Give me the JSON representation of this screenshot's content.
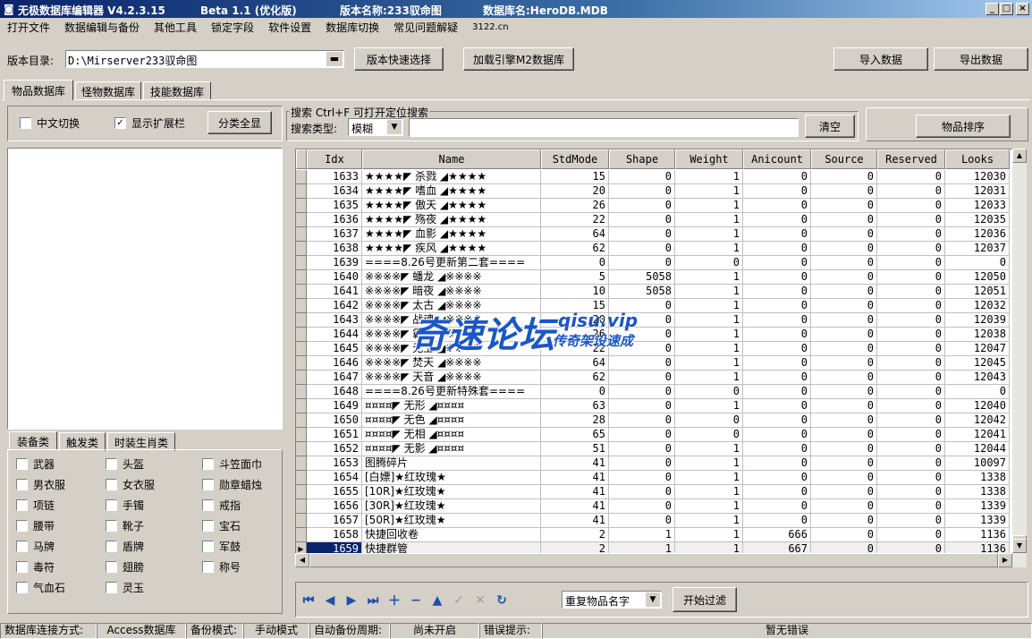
{
  "title": {
    "app": "无极数据库编辑器 V4.2.3.15",
    "beta": "Beta 1.1 (优化版)",
    "version_label": "版本名称:233驭命图",
    "db_label": "数据库名:HeroDB.MDB"
  },
  "menu": [
    "打开文件",
    "数据编辑与备份",
    "其他工具",
    "锁定字段",
    "软件设置",
    "数据库切换",
    "常见问题解疑",
    "3122.cn"
  ],
  "toolbar": {
    "dir_label": "版本目录:",
    "dir_value": "D:\\Mirserver233驭命图",
    "quick_select": "版本快速选择",
    "load_engine": "加载引擎M2数据库",
    "import": "导入数据",
    "export": "导出数据"
  },
  "tabs": [
    "物品数据库",
    "怪物数据库",
    "技能数据库"
  ],
  "left_panel": {
    "chinese_toggle": "中文切换",
    "show_ext": "显示扩展栏",
    "show_all": "分类全显",
    "cat_tabs": [
      "装备类",
      "触发类",
      "时装生肖类"
    ],
    "categories": [
      [
        "武器",
        "头盔",
        "斗笠面巾"
      ],
      [
        "男衣服",
        "女衣服",
        "勋章蜡烛"
      ],
      [
        "项链",
        "手镯",
        "戒指"
      ],
      [
        "腰带",
        "靴子",
        "宝石"
      ],
      [
        "马牌",
        "盾牌",
        "军鼓"
      ],
      [
        "毒符",
        "翅膀",
        "称号"
      ],
      [
        "气血石",
        "灵玉",
        ""
      ]
    ]
  },
  "search": {
    "title": "搜索 Ctrl+F 可打开定位搜索",
    "type_label": "搜索类型:",
    "type_value": "模糊",
    "query": "",
    "clear": "清空",
    "sort": "物品排序"
  },
  "grid": {
    "columns": [
      "Idx",
      "Name",
      "StdMode",
      "Shape",
      "Weight",
      "Anicount",
      "Source",
      "Reserved",
      "Looks"
    ],
    "rows": [
      [
        "1633",
        "★★★★◤ 杀戮 ◢★★★★",
        "15",
        "0",
        "1",
        "0",
        "0",
        "0",
        "12030"
      ],
      [
        "1634",
        "★★★★◤ 嗜血 ◢★★★★",
        "20",
        "0",
        "1",
        "0",
        "0",
        "0",
        "12031"
      ],
      [
        "1635",
        "★★★★◤ 傲天 ◢★★★★",
        "26",
        "0",
        "1",
        "0",
        "0",
        "0",
        "12033"
      ],
      [
        "1636",
        "★★★★◤ 殇夜 ◢★★★★",
        "22",
        "0",
        "1",
        "0",
        "0",
        "0",
        "12035"
      ],
      [
        "1637",
        "★★★★◤ 血影 ◢★★★★",
        "64",
        "0",
        "1",
        "0",
        "0",
        "0",
        "12036"
      ],
      [
        "1638",
        "★★★★◤ 疾风 ◢★★★★",
        "62",
        "0",
        "1",
        "0",
        "0",
        "0",
        "12037"
      ],
      [
        "1639",
        "====8.26号更新第二套====",
        "0",
        "0",
        "0",
        "0",
        "0",
        "0",
        "0"
      ],
      [
        "1640",
        "※※※※◤ 蟠龙 ◢※※※※",
        "5",
        "5058",
        "1",
        "0",
        "0",
        "0",
        "12050"
      ],
      [
        "1641",
        "※※※※◤ 暗夜 ◢※※※※",
        "10",
        "5058",
        "1",
        "0",
        "0",
        "0",
        "12051"
      ],
      [
        "1642",
        "※※※※◤ 太古 ◢※※※※",
        "15",
        "0",
        "1",
        "0",
        "0",
        "0",
        "12032"
      ],
      [
        "1643",
        "※※※※◤ 战魂 ◢※※※※",
        "20",
        "0",
        "1",
        "0",
        "0",
        "0",
        "12039"
      ],
      [
        "1644",
        "※※※※◤ 霸者 ◢※※※※",
        "26",
        "0",
        "1",
        "0",
        "0",
        "0",
        "12038"
      ],
      [
        "1645",
        "※※※※◤ 无上 ◢※※※※",
        "22",
        "0",
        "1",
        "0",
        "0",
        "0",
        "12047"
      ],
      [
        "1646",
        "※※※※◤ 焚天 ◢※※※※",
        "64",
        "0",
        "1",
        "0",
        "0",
        "0",
        "12045"
      ],
      [
        "1647",
        "※※※※◤ 天音 ◢※※※※",
        "62",
        "0",
        "1",
        "0",
        "0",
        "0",
        "12043"
      ],
      [
        "1648",
        "====8.26号更新特殊套====",
        "0",
        "0",
        "0",
        "0",
        "0",
        "0",
        "0"
      ],
      [
        "1649",
        "¤¤¤¤◤ 无形 ◢¤¤¤¤",
        "63",
        "0",
        "1",
        "0",
        "0",
        "0",
        "12040"
      ],
      [
        "1650",
        "¤¤¤¤◤ 无色 ◢¤¤¤¤",
        "28",
        "0",
        "0",
        "0",
        "0",
        "0",
        "12042"
      ],
      [
        "1651",
        "¤¤¤¤◤ 无相 ◢¤¤¤¤",
        "65",
        "0",
        "0",
        "0",
        "0",
        "0",
        "12041"
      ],
      [
        "1652",
        "¤¤¤¤◤ 无影 ◢¤¤¤¤",
        "51",
        "0",
        "1",
        "0",
        "0",
        "0",
        "12044"
      ],
      [
        "1653",
        "图腾碎片",
        "41",
        "0",
        "1",
        "0",
        "0",
        "0",
        "10097"
      ],
      [
        "1654",
        "[白嫖]★红玫瑰★",
        "41",
        "0",
        "1",
        "0",
        "0",
        "0",
        "1338"
      ],
      [
        "1655",
        "[10R]★红玫瑰★",
        "41",
        "0",
        "1",
        "0",
        "0",
        "0",
        "1338"
      ],
      [
        "1656",
        "[30R]★红玫瑰★",
        "41",
        "0",
        "1",
        "0",
        "0",
        "0",
        "1339"
      ],
      [
        "1657",
        "[50R]★红玫瑰★",
        "41",
        "0",
        "1",
        "0",
        "0",
        "0",
        "1339"
      ],
      [
        "1658",
        "快捷回收卷",
        "2",
        "1",
        "1",
        "666",
        "0",
        "0",
        "1136"
      ],
      [
        "1659",
        "快捷群管",
        "2",
        "1",
        "1",
        "667",
        "0",
        "0",
        "1136"
      ]
    ],
    "selected_index": 26
  },
  "watermark": {
    "main": "奇速论坛",
    "url": "qisu.vip",
    "sub": "传奇架设速成"
  },
  "bottom": {
    "filter_select": "重复物品名字",
    "filter_btn": "开始过滤"
  },
  "status": [
    "数据库连接方式:",
    "Access数据库",
    "备份模式:",
    "手动模式",
    "自动备份周期:",
    "尚未开启",
    "错误提示:",
    "暂无错误"
  ]
}
